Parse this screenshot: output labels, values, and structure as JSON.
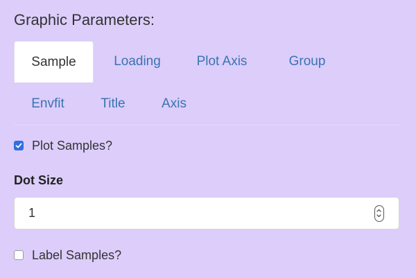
{
  "section": {
    "title": "Graphic Parameters:"
  },
  "tabs": [
    {
      "label": "Sample",
      "active": true
    },
    {
      "label": "Loading",
      "active": false
    },
    {
      "label": "Plot Axis",
      "active": false
    },
    {
      "label": "Group",
      "active": false
    },
    {
      "label": "Envfit",
      "active": false
    },
    {
      "label": "Title",
      "active": false
    },
    {
      "label": "Axis",
      "active": false
    }
  ],
  "plot_samples": {
    "label": "Plot Samples?",
    "checked": true
  },
  "dot_size": {
    "label": "Dot Size",
    "value": "1"
  },
  "label_samples": {
    "label": "Label Samples?",
    "checked": false
  },
  "colors": {
    "background": "#dccdfb",
    "link": "#3a74b0",
    "checkbox_accent": "#2f6fdf"
  },
  "icons": {
    "stepper": "number-stepper-icon",
    "check": "checkmark-icon"
  }
}
